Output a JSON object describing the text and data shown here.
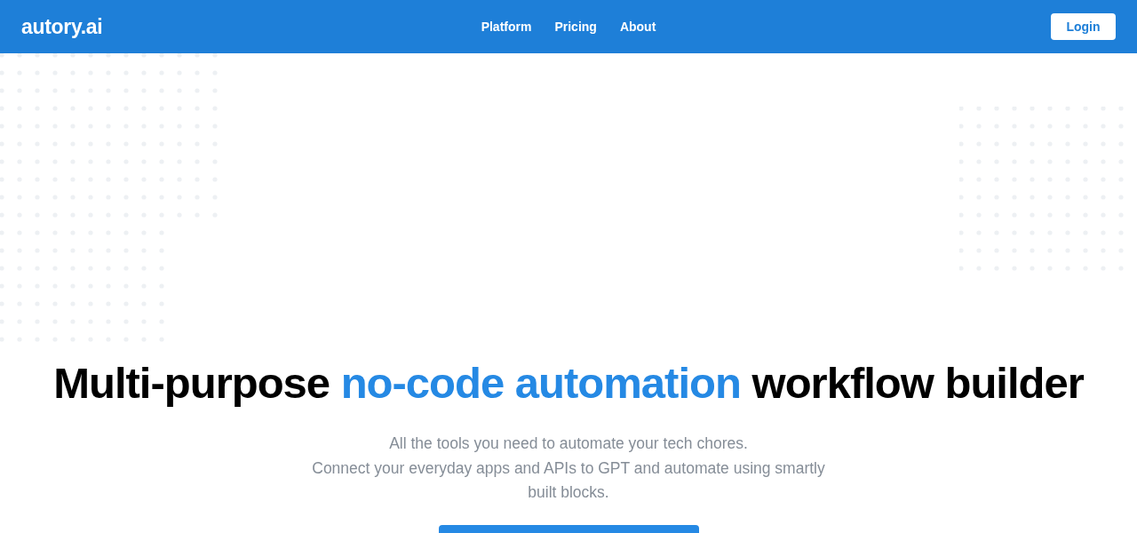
{
  "header": {
    "logo": "autory.ai",
    "nav": [
      "Platform",
      "Pricing",
      "About"
    ],
    "login": "Login"
  },
  "hero": {
    "title": {
      "before": "Multi-purpose ",
      "highlight": "no-code automation",
      "after": " workflow builder"
    },
    "subtitle": [
      "All the tools you need to automate your tech chores.",
      "Connect your everyday apps and APIs to GPT and automate using smartly built blocks."
    ],
    "cta": {
      "kind": "button"
    }
  }
}
